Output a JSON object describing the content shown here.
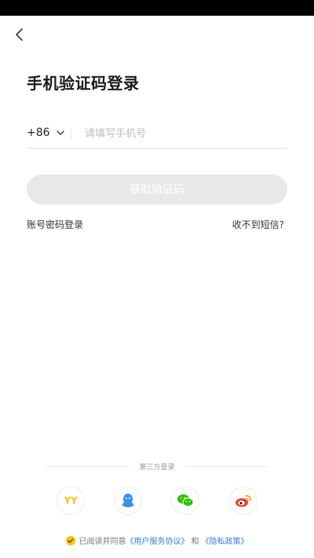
{
  "header": {
    "title": "手机验证码登录"
  },
  "form": {
    "country_code": "+86",
    "phone_placeholder": "请填写手机号",
    "phone_value": "",
    "submit_label": "获取验证码"
  },
  "links": {
    "password_login": "账号密码登录",
    "no_sms": "收不到短信?"
  },
  "third_party": {
    "label": "第三方登录",
    "providers": [
      {
        "name": "YY",
        "icon": "yy-logo-icon",
        "color": "#f2c51c"
      },
      {
        "name": "QQ",
        "icon": "qq-icon",
        "color": "#3d8ef0"
      },
      {
        "name": "WeChat",
        "icon": "wechat-icon",
        "color": "#2dc100"
      },
      {
        "name": "Weibo",
        "icon": "weibo-icon",
        "color": "#e6432e"
      }
    ]
  },
  "agreement": {
    "prefix": "已阅读并同意",
    "terms": "《用户服务协议》",
    "and": "和",
    "privacy": "《隐私政策》"
  },
  "colors": {
    "accent": "#f5c518",
    "link": "#3b7ed9",
    "disabled_button": "#e8e8e8"
  }
}
